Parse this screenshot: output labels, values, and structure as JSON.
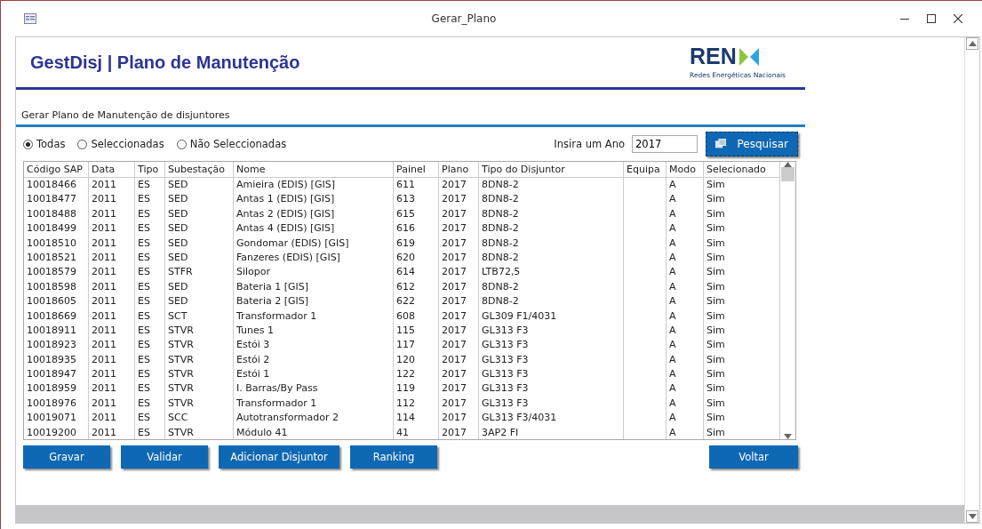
{
  "window": {
    "title": "Gerar_Plano"
  },
  "header": {
    "title": "GestDisj | Plano de Manutenção",
    "logo_text": "REN",
    "logo_subtitle": "Redes Energéticas Nacionais"
  },
  "section_title": "Gerar Plano de Manutenção de disjuntores",
  "filter": [
    {
      "label": "Todas",
      "selected": true
    },
    {
      "label": "Seleccionadas",
      "selected": false
    },
    {
      "label": "Não Seleccionadas",
      "selected": false
    }
  ],
  "year": {
    "label": "Insira um Ano",
    "value": "2017"
  },
  "search_button": "Pesquisar",
  "table": {
    "columns": [
      "Código SAP",
      "Data",
      "Tipo",
      "Subestação",
      "Nome",
      "Painel",
      "Plano",
      "Tipo do Disjuntor",
      "Equipa",
      "Modo",
      "Selecionado"
    ],
    "rows": [
      {
        "codigo_sap": "10018466",
        "data": "2011",
        "tipo": "ES",
        "subestacao": "SED",
        "nome": "Amieira (EDIS) [GIS]",
        "painel": "611",
        "plano": "2017",
        "tipo_disjuntor": "8DN8-2",
        "modo": "A",
        "selecionado": "Sim"
      },
      {
        "codigo_sap": "10018477",
        "data": "2011",
        "tipo": "ES",
        "subestacao": "SED",
        "nome": "Antas 1 (EDIS) [GIS]",
        "painel": "613",
        "plano": "2017",
        "tipo_disjuntor": "8DN8-2",
        "modo": "A",
        "selecionado": "Sim"
      },
      {
        "codigo_sap": "10018488",
        "data": "2011",
        "tipo": "ES",
        "subestacao": "SED",
        "nome": "Antas 2 (EDIS) [GIS]",
        "painel": "615",
        "plano": "2017",
        "tipo_disjuntor": "8DN8-2",
        "modo": "A",
        "selecionado": "Sim"
      },
      {
        "codigo_sap": "10018499",
        "data": "2011",
        "tipo": "ES",
        "subestacao": "SED",
        "nome": "Antas 4 (EDIS) [GIS]",
        "painel": "616",
        "plano": "2017",
        "tipo_disjuntor": "8DN8-2",
        "modo": "A",
        "selecionado": "Sim"
      },
      {
        "codigo_sap": "10018510",
        "data": "2011",
        "tipo": "ES",
        "subestacao": "SED",
        "nome": "Gondomar (EDIS) [GIS]",
        "painel": "619",
        "plano": "2017",
        "tipo_disjuntor": "8DN8-2",
        "modo": "A",
        "selecionado": "Sim"
      },
      {
        "codigo_sap": "10018521",
        "data": "2011",
        "tipo": "ES",
        "subestacao": "SED",
        "nome": "Fanzeres (EDIS) [GIS]",
        "painel": "620",
        "plano": "2017",
        "tipo_disjuntor": "8DN8-2",
        "modo": "A",
        "selecionado": "Sim"
      },
      {
        "codigo_sap": "10018579",
        "data": "2011",
        "tipo": "ES",
        "subestacao": "STFR",
        "nome": "Silopor",
        "painel": "614",
        "plano": "2017",
        "tipo_disjuntor": "LTB72,5",
        "modo": "A",
        "selecionado": "Sim"
      },
      {
        "codigo_sap": "10018598",
        "data": "2011",
        "tipo": "ES",
        "subestacao": "SED",
        "nome": "Bateria 1 [GIS]",
        "painel": "612",
        "plano": "2017",
        "tipo_disjuntor": "8DN8-2",
        "modo": "A",
        "selecionado": "Sim"
      },
      {
        "codigo_sap": "10018605",
        "data": "2011",
        "tipo": "ES",
        "subestacao": "SED",
        "nome": "Bateria 2 [GIS]",
        "painel": "622",
        "plano": "2017",
        "tipo_disjuntor": "8DN8-2",
        "modo": "A",
        "selecionado": "Sim"
      },
      {
        "codigo_sap": "10018669",
        "data": "2011",
        "tipo": "ES",
        "subestacao": "SCT",
        "nome": "Transformador 1",
        "painel": "608",
        "plano": "2017",
        "tipo_disjuntor": "GL309 F1/4031",
        "modo": "A",
        "selecionado": "Sim"
      },
      {
        "codigo_sap": "10018911",
        "data": "2011",
        "tipo": "ES",
        "subestacao": "STVR",
        "nome": "Tunes 1",
        "painel": "115",
        "plano": "2017",
        "tipo_disjuntor": "GL313 F3",
        "modo": "A",
        "selecionado": "Sim"
      },
      {
        "codigo_sap": "10018923",
        "data": "2011",
        "tipo": "ES",
        "subestacao": "STVR",
        "nome": "Estói 3",
        "painel": "117",
        "plano": "2017",
        "tipo_disjuntor": "GL313 F3",
        "modo": "A",
        "selecionado": "Sim"
      },
      {
        "codigo_sap": "10018935",
        "data": "2011",
        "tipo": "ES",
        "subestacao": "STVR",
        "nome": "Estói 2",
        "painel": "120",
        "plano": "2017",
        "tipo_disjuntor": "GL313 F3",
        "modo": "A",
        "selecionado": "Sim"
      },
      {
        "codigo_sap": "10018947",
        "data": "2011",
        "tipo": "ES",
        "subestacao": "STVR",
        "nome": "Estói 1",
        "painel": "122",
        "plano": "2017",
        "tipo_disjuntor": "GL313 F3",
        "modo": "A",
        "selecionado": "Sim"
      },
      {
        "codigo_sap": "10018959",
        "data": "2011",
        "tipo": "ES",
        "subestacao": "STVR",
        "nome": "I. Barras/By Pass",
        "painel": "119",
        "plano": "2017",
        "tipo_disjuntor": "GL313 F3",
        "modo": "A",
        "selecionado": "Sim"
      },
      {
        "codigo_sap": "10018976",
        "data": "2011",
        "tipo": "ES",
        "subestacao": "STVR",
        "nome": "Transformador 1",
        "painel": "112",
        "plano": "2017",
        "tipo_disjuntor": "GL313 F3",
        "modo": "A",
        "selecionado": "Sim"
      },
      {
        "codigo_sap": "10019071",
        "data": "2011",
        "tipo": "ES",
        "subestacao": "SCC",
        "nome": "Autotransformador 2",
        "painel": "114",
        "plano": "2017",
        "tipo_disjuntor": "GL313 F3/4031",
        "modo": "A",
        "selecionado": "Sim"
      },
      {
        "codigo_sap": "10019200",
        "data": "2011",
        "tipo": "ES",
        "subestacao": "STVR",
        "nome": "Módulo 41",
        "painel": "41",
        "plano": "2017",
        "tipo_disjuntor": "3AP2 FI",
        "modo": "A",
        "selecionado": "Sim"
      }
    ]
  },
  "buttons": [
    "Gravar",
    "Validar",
    "Adicionar Disjuntor",
    "Ranking"
  ],
  "back_button": "Voltar"
}
